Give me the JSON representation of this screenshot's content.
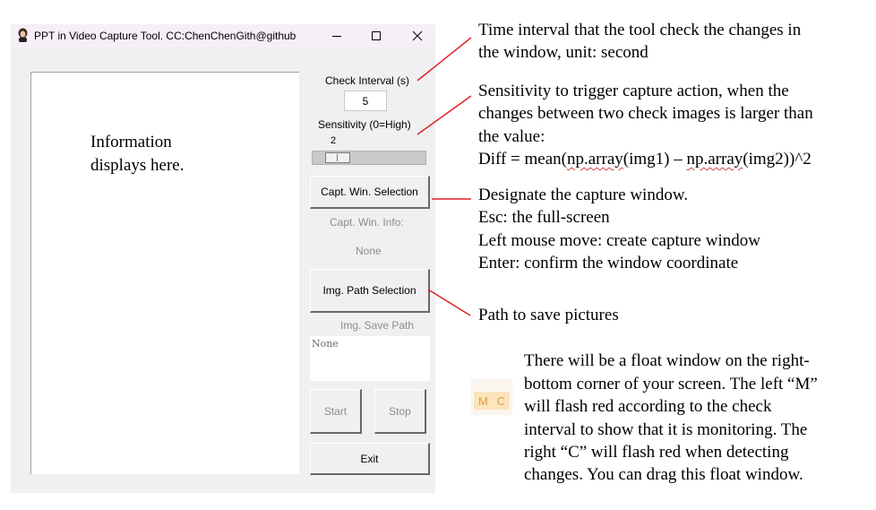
{
  "window": {
    "title": "PPT in Video Capture Tool. CC:ChenChenGith@github"
  },
  "info_panel": {
    "text_line1": "Information",
    "text_line2": "displays here."
  },
  "controls": {
    "check_interval_label": "Check Interval (s)",
    "check_interval_value": "5",
    "sensitivity_label": "Sensitivity (0=High)",
    "sensitivity_value": "2",
    "capt_win_button": "Capt. Win. Selection",
    "capt_win_info_label": "Capt. Win. Info:",
    "capt_win_info_value": "None",
    "img_path_button": "Img. Path Selection",
    "img_save_path_label": "Img. Save Path",
    "img_save_path_value": "None",
    "start_button": "Start",
    "stop_button": "Stop",
    "exit_button": "Exit"
  },
  "annotations": {
    "interval_line1": "Time interval that the tool check the changes in",
    "interval_line2": "the window, unit: second",
    "sens_line1": "Sensitivity to trigger capture action, when the",
    "sens_line2": "changes between two check images is larger than",
    "sens_line3": "the value:",
    "sens_formula_prefix": "Diff = mean(",
    "sens_formula_np1": "np.array",
    "sens_formula_mid": "(img1) – ",
    "sens_formula_np2": "np.array",
    "sens_formula_suffix": "(img2))^2",
    "capt_line1": "Designate the capture window.",
    "capt_line2": "Esc: the full-screen",
    "capt_line3": "Left mouse move: create capture window",
    "capt_line4": "Enter: confirm the window coordinate",
    "path_line1": "Path to save pictures",
    "float_line1": "There will be a float window on the right-",
    "float_line2": "bottom corner of your screen. The left “M”",
    "float_line3": "will flash red according to the check",
    "float_line4": "interval to show that it is monitoring. The",
    "float_line5": "right “C” will flash red when detecting",
    "float_line6": "changes. You can drag this float window."
  },
  "float_window": {
    "m_label": "M",
    "c_label": "C",
    "colors": {
      "background": "#fce4bc",
      "letters": "#d8a050"
    }
  },
  "colors": {
    "annotation_line": "#e0202a",
    "window_bg": "#f0f0f0",
    "titlebar_bg": "#f7eff7"
  },
  "icons": {
    "app": "avatar-icon",
    "minimize": "minimize-icon",
    "maximize": "maximize-icon",
    "close": "close-icon"
  }
}
